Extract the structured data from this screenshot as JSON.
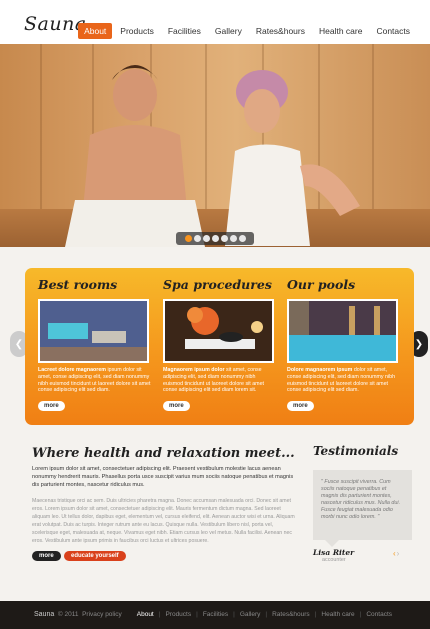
{
  "brand": {
    "logo": "Sauna"
  },
  "nav": {
    "items": [
      "About",
      "Products",
      "Facilities",
      "Gallery",
      "Rates&hours",
      "Health care",
      "Contacts"
    ],
    "active_index": 0
  },
  "hero": {
    "slide_count": 7,
    "active_slide": 1
  },
  "features": [
    {
      "title": "Best rooms",
      "lead": "Lacreet dolore magnaorem",
      "text": "ipsum dolor sit amet, conse adipiscing elit, sed diam nonummy nibh euismod tincidunt ut laoreet dolore sit amet conse adipiscing elit sed diam.",
      "more": "more"
    },
    {
      "title": "Spa procedures",
      "lead": "Magnaorem ipsum dolor",
      "text": "sit amet, conse adipiscing elit, sed diam nonummy nibh euismod tincidunt ut laoreet dolore sit amet conse adipiscing elit sed diam lorem sit.",
      "more": "more"
    },
    {
      "title": "Our pools",
      "lead": "Dolore magnaorem ipsum",
      "text": "dolor sit amet, conse adipiscing elit, sed diam nonummy nibh euismod tincidunt ut laoreet dolore sit amet conse adipiscing elit sed diam.",
      "more": "more"
    }
  ],
  "main": {
    "title": "Where health and relaxation meet...",
    "lead": "Lorem ipsum dolor sit amet, consectetuer adipiscing elit. Praesent vestibulum molestie lacus aenean nonummy hendrerit mauris. Phasellus porta usce suscipit varius mum sociis natoque penatibus et magnis dis parturient montes, nascetur ridiculus mus.",
    "body": "Maecenas tristique orci ac sem. Duis ultricies pharetra magna. Donec accumsan malesuada orci. Donec sit amet eros. Lorem ipsum dolor sit amet, consectetuer adipiscing elit. Mauris fermentum dictum magna. Sed laoreet aliquam leo. Ut tellus dolor, dapibus eget, elementum vel, cursus eleifend, elit. Aenean auctor wisi et urna. Aliquam erat volutpat. Duis ac turpis. Integer rutrum ante eu lacus. Quisque nulla. Vestibulum libero nisl, porta vel, scelerisque eget, malesuada at, neque. Vivamus eget nibh. Etiam cursus leo vel metus. Nulla facilisi. Aenean nec eros. Vestibulum ante ipsum primis in faucibus orci luctus et ultrices posuere.",
    "btn_more": "more",
    "btn_educate": "educate yourself"
  },
  "testimonials": {
    "title": "Testimonials",
    "quote": "\" Fusce suscipit viverra. Cum sociis natoque penatibus et magnis dis parturient montes, nascetur ridiculus mus. Nulla dui. Fusce feugiat malesuada odio morbi nunc odio lorem. \"",
    "name": "Lisa Riter",
    "role": "accounter",
    "prev": "‹",
    "next": "›"
  },
  "footer": {
    "brand": "Sauna",
    "copyright": "© 2011",
    "privacy": "Privacy policy",
    "nav": [
      "About",
      "Products",
      "Facilities",
      "Gallery",
      "Rates&hours",
      "Health care",
      "Contacts"
    ]
  },
  "colors": {
    "accent": "#e9651a",
    "panel_top": "#f7b92a",
    "panel_bottom": "#f07f14",
    "footer_bg": "#1e1a17"
  }
}
